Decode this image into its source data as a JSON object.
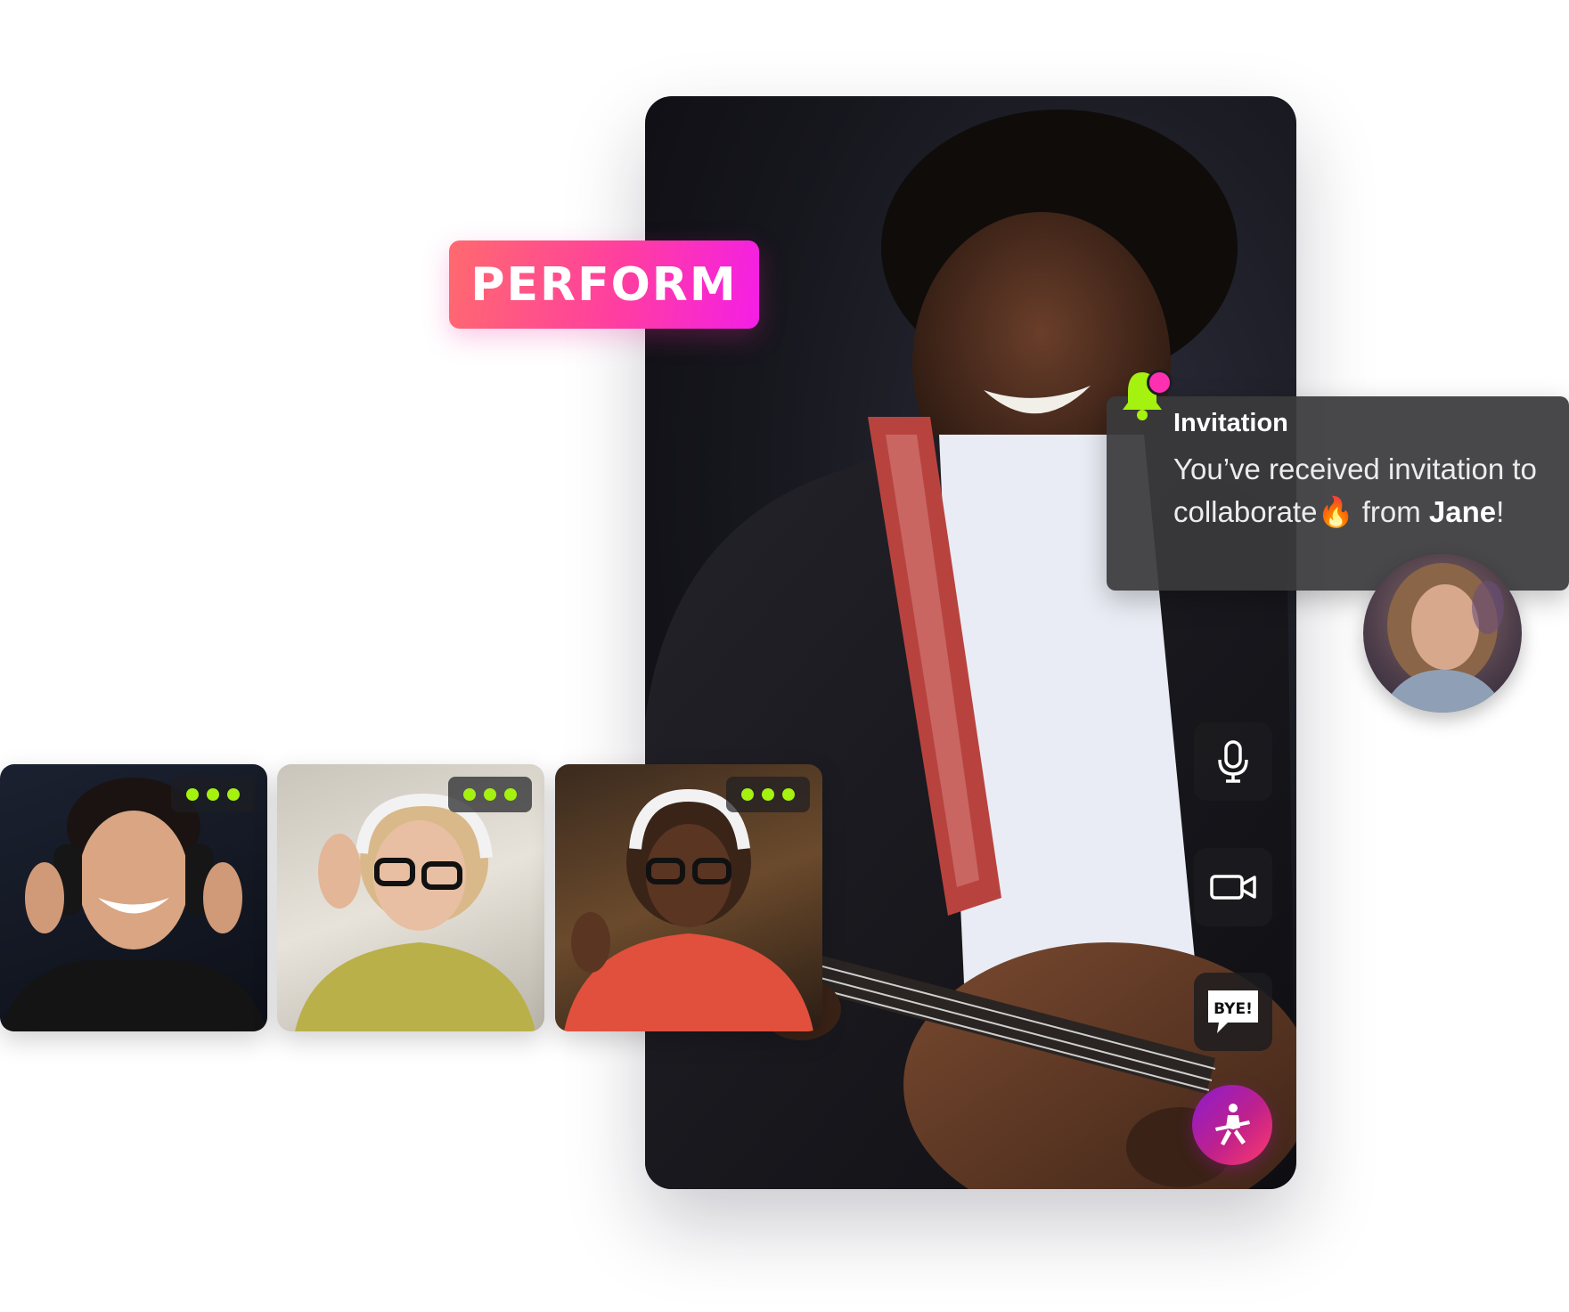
{
  "badge": {
    "label": "PERFORM"
  },
  "notification": {
    "title": "Invitation",
    "message_part1": "You’ve received invitation to collaborate",
    "emoji": "🔥",
    "message_part2": "from",
    "sender_name": "Jane",
    "message_end": "!",
    "bell_icon": "bell-icon",
    "accent_color": "#a5f10f",
    "dot_color": "#ff2fb1"
  },
  "controls": {
    "mic_icon": "microphone-icon",
    "camera_icon": "video-camera-icon",
    "bye_icon": "bye-speech-bubble-icon",
    "bye_label": "BYE!",
    "perform_icon": "guitarist-icon"
  },
  "participants": [
    {
      "name": "participant-1",
      "status_color": "#a5f10f"
    },
    {
      "name": "participant-2",
      "status_color": "#a5f10f"
    },
    {
      "name": "participant-3",
      "status_color": "#a5f10f"
    }
  ],
  "colors": {
    "badge_gradient_start": "#ff6a6e",
    "badge_gradient_end": "#f41ee6",
    "card_background": "#3a3a3c",
    "status_dot": "#a5f10f"
  }
}
